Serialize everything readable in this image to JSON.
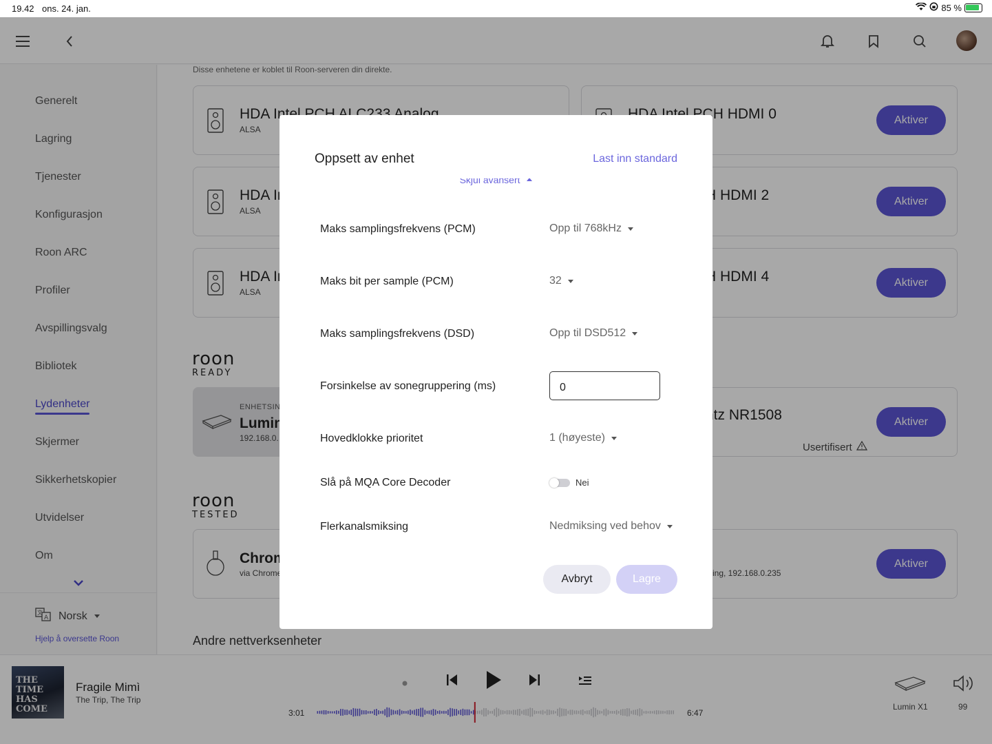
{
  "status_bar": {
    "time": "19.42",
    "date": "ons. 24. jan.",
    "battery": "85 %"
  },
  "sidebar": {
    "items": [
      {
        "label": "Generelt"
      },
      {
        "label": "Lagring"
      },
      {
        "label": "Tjenester"
      },
      {
        "label": "Konfigurasjon"
      },
      {
        "label": "Roon ARC"
      },
      {
        "label": "Profiler"
      },
      {
        "label": "Avspillingsvalg"
      },
      {
        "label": "Bibliotek"
      },
      {
        "label": "Lydenheter",
        "active": true
      },
      {
        "label": "Skjermer"
      },
      {
        "label": "Sikkerhetskopier"
      },
      {
        "label": "Utvidelser"
      },
      {
        "label": "Om"
      }
    ],
    "language": "Norsk",
    "help_link": "Hjelp å oversette Roon"
  },
  "main": {
    "intro": "Disse enhetene er koblet til Roon-serveren din direkte.",
    "local_devices": [
      {
        "name": "HDA Intel PCH ALC233 Analog",
        "sub": "ALSA"
      },
      {
        "name": "HDA Intel PCH HDMI 0",
        "sub": "",
        "button": "Aktiver"
      },
      {
        "name": "HDA In",
        "sub": "ALSA"
      },
      {
        "name": "H HDMI 2",
        "sub": "",
        "button": "Aktiver"
      },
      {
        "name": "HDA In",
        "sub": "ALSA"
      },
      {
        "name": "H HDMI 4",
        "sub": "",
        "button": "Aktiver"
      }
    ],
    "roon_ready": {
      "logo_top": "roon",
      "logo_bottom": "READY",
      "devices": [
        {
          "prefix": "ENHETSIN",
          "name": "Lumin",
          "sub": "192.168.0."
        },
        {
          "name": "ntz NR1508",
          "button": "Aktiver",
          "status": "Usertifisert"
        }
      ]
    },
    "roon_tested": {
      "logo_top": "roon",
      "logo_bottom": "TESTED",
      "devices": [
        {
          "name": "Chrom",
          "sub": "via Chrome"
        },
        {
          "name": "",
          "sub": "ming, 192.168.0.235",
          "button": "Aktiver"
        }
      ]
    },
    "other_section_title": "Andre nettverksenheter"
  },
  "modal": {
    "title": "Oppsett av enhet",
    "reset_link": "Last inn standard",
    "collapse_label": "Skjul avansert",
    "rows": {
      "max_rate_pcm": {
        "label": "Maks samplingsfrekvens (PCM)",
        "value": "Opp til 768kHz"
      },
      "max_bits_pcm": {
        "label": "Maks bit per sample (PCM)",
        "value": "32"
      },
      "max_rate_dsd": {
        "label": "Maks samplingsfrekvens (DSD)",
        "value": "Opp til DSD512"
      },
      "zone_delay": {
        "label": "Forsinkelse av sonegruppering (ms)",
        "value": "0"
      },
      "clock_priority": {
        "label": "Hovedklokke prioritet",
        "value": "1 (høyeste)"
      },
      "mqa_decoder": {
        "label": "Slå på MQA Core Decoder",
        "value": "Nei",
        "on": false
      },
      "multichannel": {
        "label": "Flerkanalsmiksing",
        "value": "Nedmiksing ved behov"
      }
    },
    "cancel_label": "Avbryt",
    "save_label": "Lagre"
  },
  "player": {
    "album_art_text": "THE TIME HAS COME",
    "track_title": "Fragile Mimì",
    "track_sub": "The Trip, The Trip",
    "time_current": "3:01",
    "time_total": "6:47",
    "progress": 0.44,
    "zone_name": "Lumin X1",
    "volume": "99"
  },
  "colors": {
    "accent": "#5b55d5",
    "accent_light": "#d3d1f6"
  }
}
